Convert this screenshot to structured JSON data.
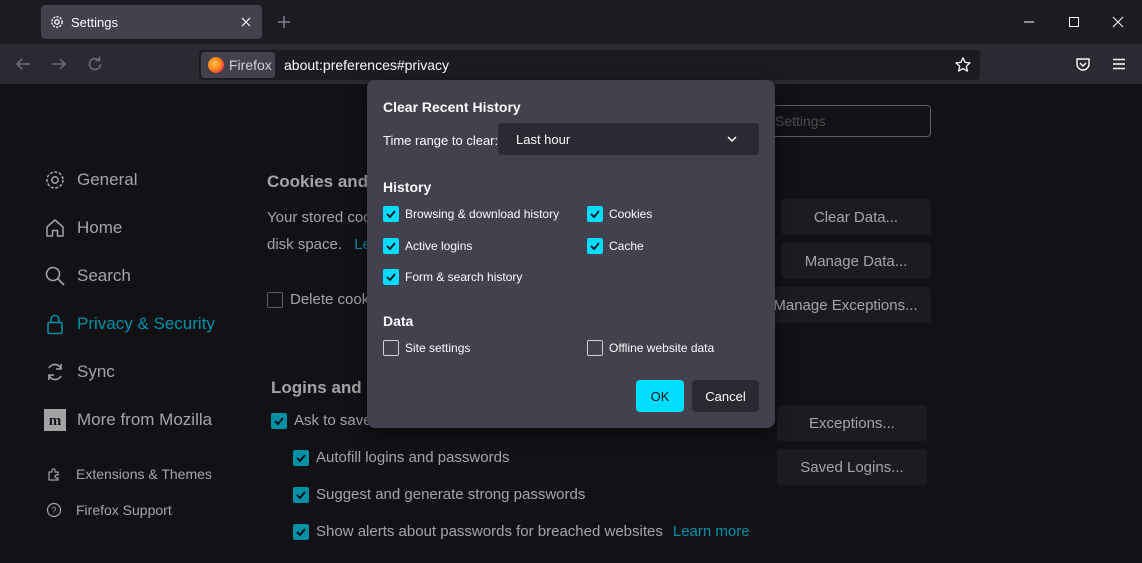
{
  "tab": {
    "title": "Settings"
  },
  "urlbar": {
    "identity_label": "Firefox",
    "url": "about:preferences#privacy"
  },
  "sidebar": {
    "items": [
      {
        "label": "General"
      },
      {
        "label": "Home"
      },
      {
        "label": "Search"
      },
      {
        "label": "Privacy & Security"
      },
      {
        "label": "Sync"
      },
      {
        "label": "More from Mozilla"
      }
    ],
    "footer": [
      {
        "label": "Extensions & Themes"
      },
      {
        "label": "Firefox Support"
      }
    ]
  },
  "find": {
    "placeholder": "Settings"
  },
  "cookies": {
    "title": "Cookies and",
    "text1": "Your stored coo",
    "text2": "disk space.",
    "link": "Le",
    "delete_label": "Delete cook",
    "clear_button": "Clear Data...",
    "manage_button": "Manage Data...",
    "exceptions_button": "Manage Exceptions..."
  },
  "logins": {
    "title": "Logins and P",
    "ask_label": "Ask to save",
    "autofill_label": "Autofill logins and passwords",
    "suggest_label": "Suggest and generate strong passwords",
    "alerts_label": "Show alerts about passwords for breached websites",
    "learn_more": "Learn more",
    "exceptions_button": "Exceptions...",
    "saved_button": "Saved Logins..."
  },
  "dialog": {
    "title": "Clear Recent History",
    "time_range_label": "Time range to clear:",
    "time_range_value": "Last hour",
    "history_heading": "History",
    "history_items": [
      {
        "label": "Browsing & download history",
        "checked": true
      },
      {
        "label": "Cookies",
        "checked": true
      },
      {
        "label": "Active logins",
        "checked": true
      },
      {
        "label": "Cache",
        "checked": true
      },
      {
        "label": "Form & search history",
        "checked": true
      }
    ],
    "data_heading": "Data",
    "data_items": [
      {
        "label": "Site settings",
        "checked": false
      },
      {
        "label": "Offline website data",
        "checked": false
      }
    ],
    "ok_label": "OK",
    "cancel_label": "Cancel"
  },
  "colors": {
    "accent": "#00ddff",
    "dialog_bg": "#42414d",
    "page_bg": "#1c1b22"
  }
}
